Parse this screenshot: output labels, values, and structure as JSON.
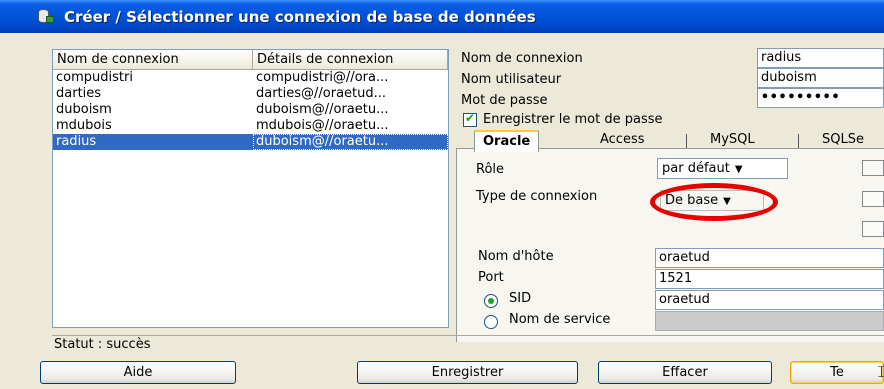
{
  "window": {
    "title": "Créer / Sélectionner une connexion de base de données"
  },
  "connections": {
    "headers": [
      "Nom de connexion",
      "Détails de connexion"
    ],
    "rows": [
      {
        "name": "compudistri",
        "details": "compudistri@//ora...",
        "selected": false
      },
      {
        "name": "darties",
        "details": "darties@//oraetud...",
        "selected": false
      },
      {
        "name": "duboism",
        "details": "duboism@//oraetu...",
        "selected": false
      },
      {
        "name": "mdubois",
        "details": "mdubois@//oraetu...",
        "selected": false
      },
      {
        "name": "radius",
        "details": "duboism@//oraetu...",
        "selected": true
      }
    ]
  },
  "form": {
    "connection_name_label": "Nom de connexion",
    "connection_name_value": "radius",
    "username_label": "Nom utilisateur",
    "username_value": "duboism",
    "password_label": "Mot de passe",
    "password_value": "•••••••••",
    "save_password_label": "Enregistrer le mot de passe",
    "save_password_checked": true
  },
  "tabs": [
    {
      "label": "Oracle",
      "active": true
    },
    {
      "label": "Access",
      "active": false
    },
    {
      "label": "MySQL",
      "active": false
    },
    {
      "label": "SQLSe",
      "active": false
    }
  ],
  "oracle": {
    "role_label": "Rôle",
    "role_value": "par défaut",
    "connection_type_label": "Type de connexion",
    "connection_type_value": "De base",
    "hostname_label": "Nom d'hôte",
    "hostname_value": "oraetud",
    "port_label": "Port",
    "port_value": "1521",
    "sid_label": "SID",
    "sid_value": "oraetud",
    "service_name_label": "Nom de service",
    "service_name_value": "",
    "selected_radio": "SID"
  },
  "status": {
    "text": "Statut : succès"
  },
  "buttons": {
    "help": "Aide",
    "save": "Enregistrer",
    "clear": "Effacer",
    "test": "Te"
  },
  "colors": {
    "titlebar": "#0052d6",
    "selection": "#316ac5",
    "annotation_circle": "#e60000",
    "checkmark": "#21a121"
  }
}
